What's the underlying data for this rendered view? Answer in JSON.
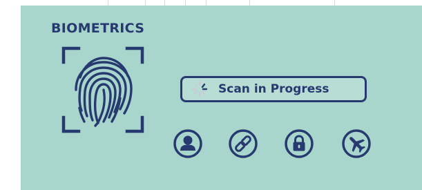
{
  "header": {
    "title": "BIOMETRICS"
  },
  "scanner": {
    "icon": "fingerprint-icon",
    "frame": "corner-brackets"
  },
  "status": {
    "icon": "loading-spinner-icon",
    "label": "Scan in Progress"
  },
  "actions": [
    {
      "icon": "user-icon"
    },
    {
      "icon": "link-icon"
    },
    {
      "icon": "lock-icon"
    },
    {
      "icon": "airplane-icon"
    }
  ],
  "colors": {
    "panel_background": "#a9d6cc",
    "ink": "#273a70",
    "spinner_light": "#c7cbd8"
  }
}
